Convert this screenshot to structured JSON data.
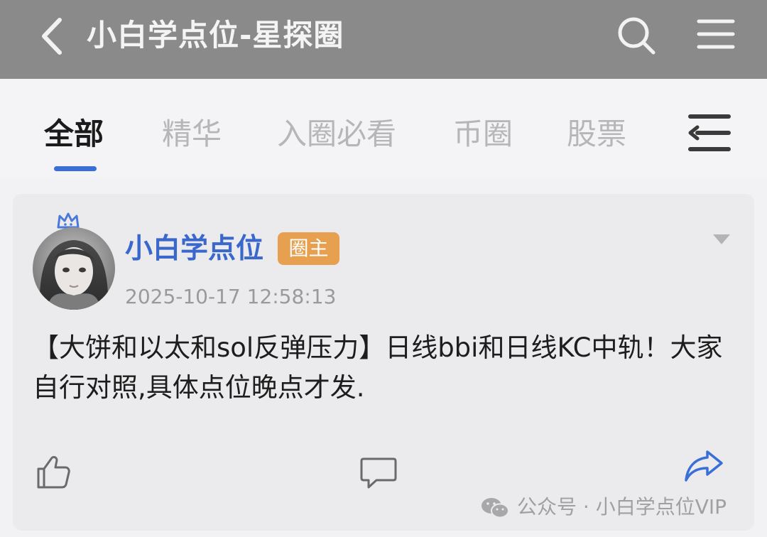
{
  "header": {
    "title": "小白学点位-星探圈",
    "back_icon": "chevron-left-icon",
    "search_icon": "search-icon",
    "menu_icon": "hamburger-menu-icon"
  },
  "tabs": [
    {
      "label": "全部",
      "active": true
    },
    {
      "label": "精华",
      "active": false
    },
    {
      "label": "入圈必看",
      "active": false
    },
    {
      "label": "币圈",
      "active": false
    },
    {
      "label": "股票",
      "active": false
    }
  ],
  "tabs_more_icon": "collapse-list-icon",
  "post": {
    "author": "小白学点位",
    "badge": "圈主",
    "timestamp": "2025-10-17 12:58:13",
    "content": "【大饼和以太和sol反弹压力】日线bbi和日线KC中轨！大家自行对照,具体点位晚点才发.",
    "actions": {
      "like_icon": "thumbs-up-icon",
      "comment_icon": "comment-icon",
      "share_icon": "share-icon"
    }
  },
  "watermark": {
    "text": "公众号 · 小白学点位VIP"
  },
  "colors": {
    "topbar": "#8a8a8a",
    "accent": "#3b6fd8",
    "author": "#3a67cc",
    "badge": "#e6a050"
  }
}
